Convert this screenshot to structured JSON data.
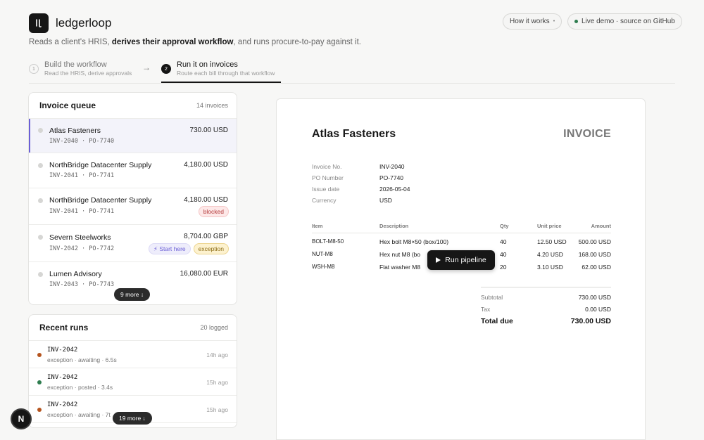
{
  "header": {
    "brand": "ledgerloop",
    "tagline_pre": "Reads a client's HRIS, ",
    "tagline_bold": "derives their approval workflow",
    "tagline_post": ", and runs procure-to-pay against it.",
    "how_it_works": "How it works",
    "live_demo": "Live demo · source on GitHub"
  },
  "steps": [
    {
      "num": "1",
      "title": "Build the workflow",
      "sub": "Read the HRIS, derive approvals"
    },
    {
      "num": "2",
      "title": "Run it on invoices",
      "sub": "Route each bill through that workflow"
    }
  ],
  "queue": {
    "title": "Invoice queue",
    "count": "14 invoices",
    "items": [
      {
        "name": "Atlas Fasteners",
        "amount": "730.00 USD",
        "ids": "INV-2040 · PO-7740"
      },
      {
        "name": "NorthBridge Datacenter Supply",
        "amount": "4,180.00 USD",
        "ids": "INV-2041 · PO-7741"
      },
      {
        "name": "NorthBridge Datacenter Supply",
        "amount": "4,180.00 USD",
        "ids": "INV-2041 · PO-7741",
        "tag": "blocked"
      },
      {
        "name": "Severn Steelworks",
        "amount": "8,704.00 GBP",
        "ids": "INV-2042 · PO-7742",
        "start": "⚡ Start here",
        "tag": "exception"
      },
      {
        "name": "Lumen Advisory",
        "amount": "16,080.00 EUR",
        "ids": "INV-2043 · PO-7743"
      }
    ],
    "more": "9 more ↓"
  },
  "runs": {
    "title": "Recent runs",
    "count": "20 logged",
    "items": [
      {
        "id": "INV-2042",
        "sub": "exception · awaiting · 6.5s",
        "time": "14h ago",
        "color": "#b5541e"
      },
      {
        "id": "INV-2042",
        "sub": "exception · posted · 3.4s",
        "time": "15h ago",
        "color": "#2e7d4f"
      },
      {
        "id": "INV-2042",
        "sub": "exception · awaiting · 7t",
        "time": "15h ago",
        "color": "#b5541e"
      }
    ],
    "more": "19 more ↓"
  },
  "invoice": {
    "vendor": "Atlas Fasteners",
    "word": "INVOICE",
    "meta": [
      {
        "k": "Invoice No.",
        "v": "INV-2040"
      },
      {
        "k": "PO Number",
        "v": "PO-7740"
      },
      {
        "k": "Issue date",
        "v": "2026-05-04"
      },
      {
        "k": "Currency",
        "v": "USD"
      }
    ],
    "headers": {
      "item": "Item",
      "desc": "Description",
      "qty": "Qty",
      "unit": "Unit price",
      "amount": "Amount"
    },
    "lines": [
      {
        "item": "BOLT-M8-50",
        "desc": "Hex bolt M8×50 (box/100)",
        "qty": "40",
        "unit": "12.50 USD",
        "amount": "500.00 USD"
      },
      {
        "item": "NUT-M8",
        "desc": "Hex nut M8 (bo",
        "qty": "40",
        "unit": "4.20 USD",
        "amount": "168.00 USD"
      },
      {
        "item": "WSH-M8",
        "desc": "Flat washer M8",
        "qty": "20",
        "unit": "3.10 USD",
        "amount": "62.00 USD"
      }
    ],
    "subtotal_k": "Subtotal",
    "subtotal_v": "730.00 USD",
    "tax_k": "Tax",
    "tax_v": "0.00 USD",
    "total_k": "Total due",
    "total_v": "730.00 USD"
  },
  "run_pipeline": "Run pipeline",
  "badge": "N"
}
